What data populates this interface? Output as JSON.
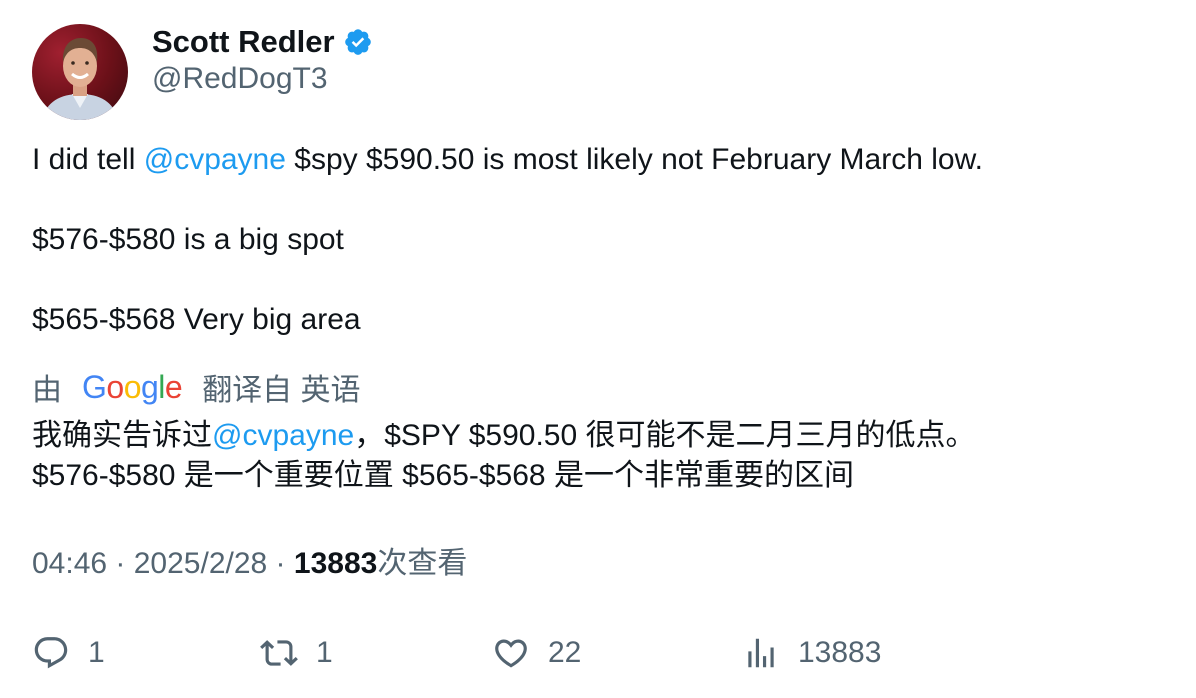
{
  "author": {
    "name": "Scott Redler",
    "handle": "@RedDogT3",
    "verified": true
  },
  "tweet": {
    "line1_prefix": "I did tell ",
    "line1_mention": "@cvpayne",
    "line1_suffix": " $spy $590.50 is most likely not February March low.",
    "line2": "$576-$580 is a big spot",
    "line3": "$565-$568 Very big area"
  },
  "translation": {
    "by_label": "由",
    "google_logo_text": "Google",
    "translated_from_label": "翻译自 英语",
    "line1_prefix": "我确实告诉过",
    "line1_mention": "@cvpayne",
    "line1_suffix": "，$SPY $590.50 很可能不是二月三月的低点。",
    "line2": "$576-$580 是一个重要位置 $565-$568 是一个非常重要的区间"
  },
  "meta": {
    "time": "04:46",
    "separator": " · ",
    "date": "2025/2/28",
    "separator2": " · ",
    "views_count": "13883",
    "views_label": "次查看"
  },
  "actions": {
    "replies": "1",
    "retweets": "1",
    "likes": "22",
    "views": "13883"
  },
  "colors": {
    "link": "#1d9bf0",
    "muted": "#536471",
    "text": "#0f1419",
    "verified": "#1d9bf0"
  }
}
